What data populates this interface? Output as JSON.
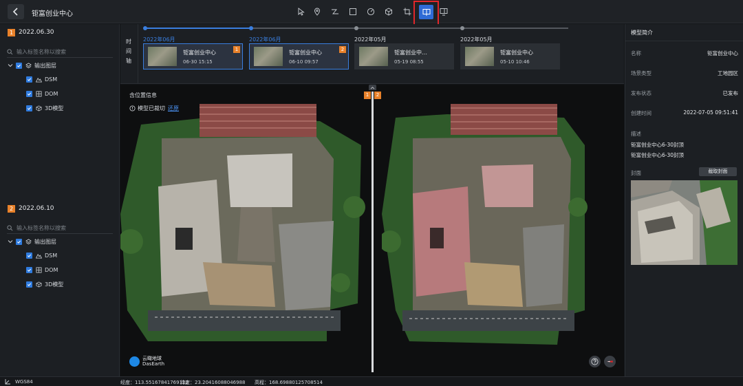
{
  "app": {
    "title": "钜富创业中心"
  },
  "toolbar": {
    "tools": [
      {
        "name": "select-tool",
        "icon": "cursor-icon"
      },
      {
        "name": "point-tool",
        "icon": "location-pin-icon"
      },
      {
        "name": "line-measure-tool",
        "icon": "polyline-icon"
      },
      {
        "name": "area-measure-tool",
        "icon": "square-icon"
      },
      {
        "name": "angle-tool",
        "icon": "gauge-icon"
      },
      {
        "name": "volume-tool",
        "icon": "cube-icon"
      },
      {
        "name": "crop-tool",
        "icon": "crop-icon"
      },
      {
        "name": "split-compare-tool",
        "icon": "split-screen-icon",
        "active": true
      },
      {
        "name": "multi-window-tool",
        "icon": "window-icon"
      }
    ]
  },
  "left_panel": {
    "groups": [
      {
        "badge": "1",
        "date": "2022.06.30",
        "search_placeholder": "输入标签名称以搜索",
        "root_label": "输出图层",
        "items": [
          {
            "label": "DSM",
            "icon": "terrain-icon"
          },
          {
            "label": "DOM",
            "icon": "grid-icon"
          },
          {
            "label": "3D模型",
            "icon": "cube-icon"
          }
        ]
      },
      {
        "badge": "2",
        "date": "2022.06.10",
        "search_placeholder": "输入标签名称以搜索",
        "root_label": "输出图层",
        "items": [
          {
            "label": "DSM",
            "icon": "terrain-icon"
          },
          {
            "label": "DOM",
            "icon": "grid-icon"
          },
          {
            "label": "3D模型",
            "icon": "cube-icon"
          }
        ]
      }
    ]
  },
  "timeline": {
    "label": "时间轴",
    "label_chars": [
      "时",
      "间",
      "轴"
    ],
    "entries": [
      {
        "date": "2022年06月",
        "name": "钜富创业中心",
        "time": "06-30 15:15",
        "badge": "1",
        "selected": true
      },
      {
        "date": "2022年06月",
        "name": "钜富创业中心",
        "time": "06-10 09:57",
        "badge": "2",
        "selected": true
      },
      {
        "date": "2022年05月",
        "name": "钜富创业中…",
        "time": "05-19 08:55",
        "badge": "",
        "selected": false
      },
      {
        "date": "2022年05月",
        "name": "钜富创业中心",
        "time": "05-10 10:46",
        "badge": "",
        "selected": false
      }
    ],
    "colors": {
      "active": "#3a7fe0",
      "inactive": "#8a8f95"
    }
  },
  "viewer": {
    "location_label": "含位置信息",
    "crop_notice": "模型已裁切",
    "restore_link": "还原",
    "split_badges": [
      "1",
      "2"
    ],
    "brand_name": "云瞰地球",
    "brand_sub": "DasEarth",
    "buttons": [
      {
        "name": "help-button",
        "icon": "question-icon"
      },
      {
        "name": "compass-button",
        "icon": "compass-icon"
      }
    ]
  },
  "right_panel": {
    "title": "模型简介",
    "fields": [
      {
        "key": "名称",
        "value": "钜富创业中心"
      },
      {
        "key": "场景类型",
        "value": "工地园区"
      },
      {
        "key": "发布状态",
        "value": "已发布"
      },
      {
        "key": "创建时间",
        "value": "2022-07-05 09:51:41"
      }
    ],
    "description_label": "描述",
    "description_lines": [
      "钜富创业中心6-30封顶",
      "钜富创业中心6-30封顶"
    ],
    "cover_label": "封面",
    "cover_button": "截取封面"
  },
  "status_bar": {
    "crs": "WGS84",
    "longitude_label": "经度：",
    "longitude": "113.55167841769122",
    "latitude_label": "纬度：",
    "latitude": "23.20416088046988",
    "altitude_label": "高程：",
    "altitude": "168.69880125708514"
  },
  "colors": {
    "accent": "#2f6bd6",
    "badge": "#e8812a",
    "highlight_outline": "#e3262a",
    "background": "#121417",
    "panel": "#1c1f23"
  }
}
